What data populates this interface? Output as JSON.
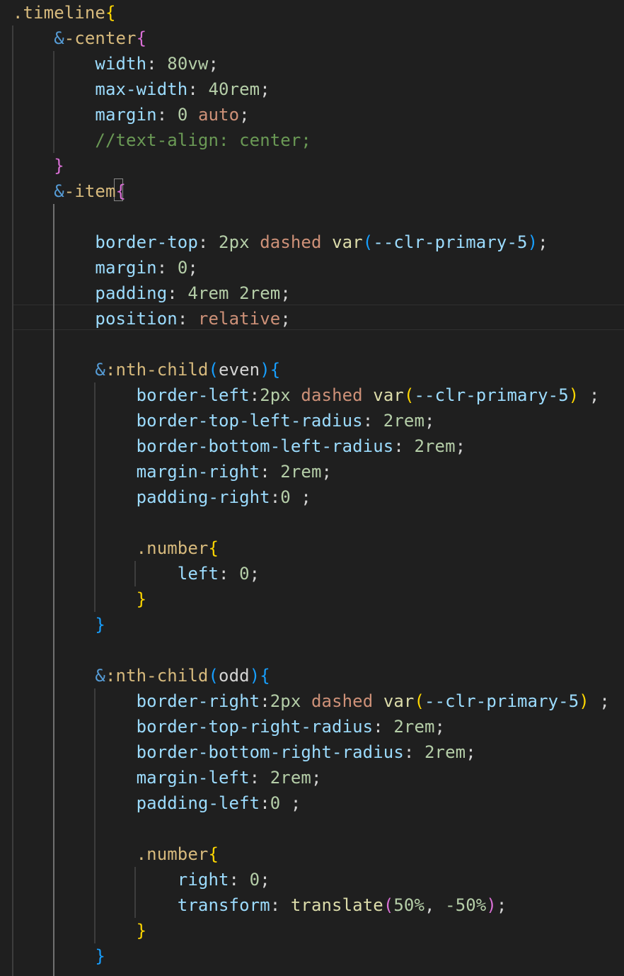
{
  "colors": {
    "background": "#1f1f1f",
    "default": "#d4d4d4",
    "selector": "#d7ba7d",
    "nesting": "#569cd6",
    "property": "#9cdcfe",
    "number": "#b5cea8",
    "keyword_value": "#ce9178",
    "function": "#dcdcaa",
    "variable": "#9cdcfe",
    "comment": "#6a9955",
    "bracket_1": "#ffd700",
    "bracket_2": "#da70d6",
    "bracket_3": "#179fff"
  },
  "lines": [
    {
      "indent": 0,
      "tokens": [
        {
          "t": ".timeline",
          "c": "selector"
        },
        {
          "t": "{",
          "c": "bracket_1"
        }
      ]
    },
    {
      "indent": 1,
      "tokens": [
        {
          "t": "&",
          "c": "nesting"
        },
        {
          "t": "-center",
          "c": "selector"
        },
        {
          "t": "{",
          "c": "bracket_2"
        }
      ]
    },
    {
      "indent": 2,
      "tokens": [
        {
          "t": "width",
          "c": "property"
        },
        {
          "t": ": ",
          "c": "default"
        },
        {
          "t": "80vw",
          "c": "number"
        },
        {
          "t": ";",
          "c": "default"
        }
      ]
    },
    {
      "indent": 2,
      "tokens": [
        {
          "t": "max-width",
          "c": "property"
        },
        {
          "t": ": ",
          "c": "default"
        },
        {
          "t": "40rem",
          "c": "number"
        },
        {
          "t": ";",
          "c": "default"
        }
      ]
    },
    {
      "indent": 2,
      "tokens": [
        {
          "t": "margin",
          "c": "property"
        },
        {
          "t": ": ",
          "c": "default"
        },
        {
          "t": "0",
          "c": "number"
        },
        {
          "t": " ",
          "c": "default"
        },
        {
          "t": "auto",
          "c": "keyword_value"
        },
        {
          "t": ";",
          "c": "default"
        }
      ]
    },
    {
      "indent": 2,
      "tokens": [
        {
          "t": "//text-align: center;",
          "c": "comment"
        }
      ]
    },
    {
      "indent": 1,
      "tokens": [
        {
          "t": "}",
          "c": "bracket_2"
        }
      ]
    },
    {
      "indent": 1,
      "tokens": [
        {
          "t": "&",
          "c": "nesting"
        },
        {
          "t": "-item",
          "c": "selector"
        },
        {
          "t": "{",
          "c": "bracket_2"
        }
      ]
    },
    {
      "indent": 0,
      "tokens": []
    },
    {
      "indent": 2,
      "tokens": [
        {
          "t": "border-top",
          "c": "property"
        },
        {
          "t": ": ",
          "c": "default"
        },
        {
          "t": "2px",
          "c": "number"
        },
        {
          "t": " ",
          "c": "default"
        },
        {
          "t": "dashed",
          "c": "keyword_value"
        },
        {
          "t": " ",
          "c": "default"
        },
        {
          "t": "var",
          "c": "function"
        },
        {
          "t": "(",
          "c": "bracket_3"
        },
        {
          "t": "--clr-primary-5",
          "c": "variable"
        },
        {
          "t": ")",
          "c": "bracket_3"
        },
        {
          "t": ";",
          "c": "default"
        }
      ]
    },
    {
      "indent": 2,
      "tokens": [
        {
          "t": "margin",
          "c": "property"
        },
        {
          "t": ": ",
          "c": "default"
        },
        {
          "t": "0",
          "c": "number"
        },
        {
          "t": ";",
          "c": "default"
        }
      ]
    },
    {
      "indent": 2,
      "tokens": [
        {
          "t": "padding",
          "c": "property"
        },
        {
          "t": ": ",
          "c": "default"
        },
        {
          "t": "4rem",
          "c": "number"
        },
        {
          "t": " ",
          "c": "default"
        },
        {
          "t": "2rem",
          "c": "number"
        },
        {
          "t": ";",
          "c": "default"
        }
      ]
    },
    {
      "indent": 2,
      "tokens": [
        {
          "t": "position",
          "c": "property"
        },
        {
          "t": ": ",
          "c": "default"
        },
        {
          "t": "relative",
          "c": "keyword_value"
        },
        {
          "t": ";",
          "c": "default"
        }
      ]
    },
    {
      "indent": 0,
      "tokens": []
    },
    {
      "indent": 2,
      "tokens": [
        {
          "t": "&",
          "c": "nesting"
        },
        {
          "t": ":nth-child",
          "c": "selector"
        },
        {
          "t": "(",
          "c": "bracket_3"
        },
        {
          "t": "even",
          "c": "default"
        },
        {
          "t": ")",
          "c": "bracket_3"
        },
        {
          "t": "{",
          "c": "bracket_3"
        }
      ]
    },
    {
      "indent": 3,
      "tokens": [
        {
          "t": "border-left",
          "c": "property"
        },
        {
          "t": ":",
          "c": "default"
        },
        {
          "t": "2px",
          "c": "number"
        },
        {
          "t": " ",
          "c": "default"
        },
        {
          "t": "dashed",
          "c": "keyword_value"
        },
        {
          "t": " ",
          "c": "default"
        },
        {
          "t": "var",
          "c": "function"
        },
        {
          "t": "(",
          "c": "bracket_1"
        },
        {
          "t": "--clr-primary-5",
          "c": "variable"
        },
        {
          "t": ")",
          "c": "bracket_1"
        },
        {
          "t": " ;",
          "c": "default"
        }
      ]
    },
    {
      "indent": 3,
      "tokens": [
        {
          "t": "border-top-left-radius",
          "c": "property"
        },
        {
          "t": ": ",
          "c": "default"
        },
        {
          "t": "2rem",
          "c": "number"
        },
        {
          "t": ";",
          "c": "default"
        }
      ]
    },
    {
      "indent": 3,
      "tokens": [
        {
          "t": "border-bottom-left-radius",
          "c": "property"
        },
        {
          "t": ": ",
          "c": "default"
        },
        {
          "t": "2rem",
          "c": "number"
        },
        {
          "t": ";",
          "c": "default"
        }
      ]
    },
    {
      "indent": 3,
      "tokens": [
        {
          "t": "margin-right",
          "c": "property"
        },
        {
          "t": ": ",
          "c": "default"
        },
        {
          "t": "2rem",
          "c": "number"
        },
        {
          "t": ";",
          "c": "default"
        }
      ]
    },
    {
      "indent": 3,
      "tokens": [
        {
          "t": "padding-right",
          "c": "property"
        },
        {
          "t": ":",
          "c": "default"
        },
        {
          "t": "0",
          "c": "number"
        },
        {
          "t": " ;",
          "c": "default"
        }
      ]
    },
    {
      "indent": 0,
      "tokens": []
    },
    {
      "indent": 3,
      "tokens": [
        {
          "t": ".number",
          "c": "selector"
        },
        {
          "t": "{",
          "c": "bracket_1"
        }
      ]
    },
    {
      "indent": 4,
      "tokens": [
        {
          "t": "left",
          "c": "property"
        },
        {
          "t": ": ",
          "c": "default"
        },
        {
          "t": "0",
          "c": "number"
        },
        {
          "t": ";",
          "c": "default"
        }
      ]
    },
    {
      "indent": 3,
      "tokens": [
        {
          "t": "}",
          "c": "bracket_1"
        }
      ]
    },
    {
      "indent": 2,
      "tokens": [
        {
          "t": "}",
          "c": "bracket_3"
        }
      ]
    },
    {
      "indent": 0,
      "tokens": []
    },
    {
      "indent": 2,
      "tokens": [
        {
          "t": "&",
          "c": "nesting"
        },
        {
          "t": ":nth-child",
          "c": "selector"
        },
        {
          "t": "(",
          "c": "bracket_3"
        },
        {
          "t": "odd",
          "c": "default"
        },
        {
          "t": ")",
          "c": "bracket_3"
        },
        {
          "t": "{",
          "c": "bracket_3"
        }
      ]
    },
    {
      "indent": 3,
      "tokens": [
        {
          "t": "border-right",
          "c": "property"
        },
        {
          "t": ":",
          "c": "default"
        },
        {
          "t": "2px",
          "c": "number"
        },
        {
          "t": " ",
          "c": "default"
        },
        {
          "t": "dashed",
          "c": "keyword_value"
        },
        {
          "t": " ",
          "c": "default"
        },
        {
          "t": "var",
          "c": "function"
        },
        {
          "t": "(",
          "c": "bracket_1"
        },
        {
          "t": "--clr-primary-5",
          "c": "variable"
        },
        {
          "t": ")",
          "c": "bracket_1"
        },
        {
          "t": " ;",
          "c": "default"
        }
      ]
    },
    {
      "indent": 3,
      "tokens": [
        {
          "t": "border-top-right-radius",
          "c": "property"
        },
        {
          "t": ": ",
          "c": "default"
        },
        {
          "t": "2rem",
          "c": "number"
        },
        {
          "t": ";",
          "c": "default"
        }
      ]
    },
    {
      "indent": 3,
      "tokens": [
        {
          "t": "border-bottom-right-radius",
          "c": "property"
        },
        {
          "t": ": ",
          "c": "default"
        },
        {
          "t": "2rem",
          "c": "number"
        },
        {
          "t": ";",
          "c": "default"
        }
      ]
    },
    {
      "indent": 3,
      "tokens": [
        {
          "t": "margin-left",
          "c": "property"
        },
        {
          "t": ": ",
          "c": "default"
        },
        {
          "t": "2rem",
          "c": "number"
        },
        {
          "t": ";",
          "c": "default"
        }
      ]
    },
    {
      "indent": 3,
      "tokens": [
        {
          "t": "padding-left",
          "c": "property"
        },
        {
          "t": ":",
          "c": "default"
        },
        {
          "t": "0",
          "c": "number"
        },
        {
          "t": " ;",
          "c": "default"
        }
      ]
    },
    {
      "indent": 0,
      "tokens": []
    },
    {
      "indent": 3,
      "tokens": [
        {
          "t": ".number",
          "c": "selector"
        },
        {
          "t": "{",
          "c": "bracket_1"
        }
      ]
    },
    {
      "indent": 4,
      "tokens": [
        {
          "t": "right",
          "c": "property"
        },
        {
          "t": ": ",
          "c": "default"
        },
        {
          "t": "0",
          "c": "number"
        },
        {
          "t": ";",
          "c": "default"
        }
      ]
    },
    {
      "indent": 4,
      "tokens": [
        {
          "t": "transform",
          "c": "property"
        },
        {
          "t": ": ",
          "c": "default"
        },
        {
          "t": "translate",
          "c": "function"
        },
        {
          "t": "(",
          "c": "bracket_2"
        },
        {
          "t": "50%",
          "c": "number"
        },
        {
          "t": ", ",
          "c": "default"
        },
        {
          "t": "-50%",
          "c": "number"
        },
        {
          "t": ")",
          "c": "bracket_2"
        },
        {
          "t": ";",
          "c": "default"
        }
      ]
    },
    {
      "indent": 3,
      "tokens": [
        {
          "t": "}",
          "c": "bracket_1"
        }
      ]
    },
    {
      "indent": 2,
      "tokens": [
        {
          "t": "}",
          "c": "bracket_3"
        }
      ]
    }
  ]
}
